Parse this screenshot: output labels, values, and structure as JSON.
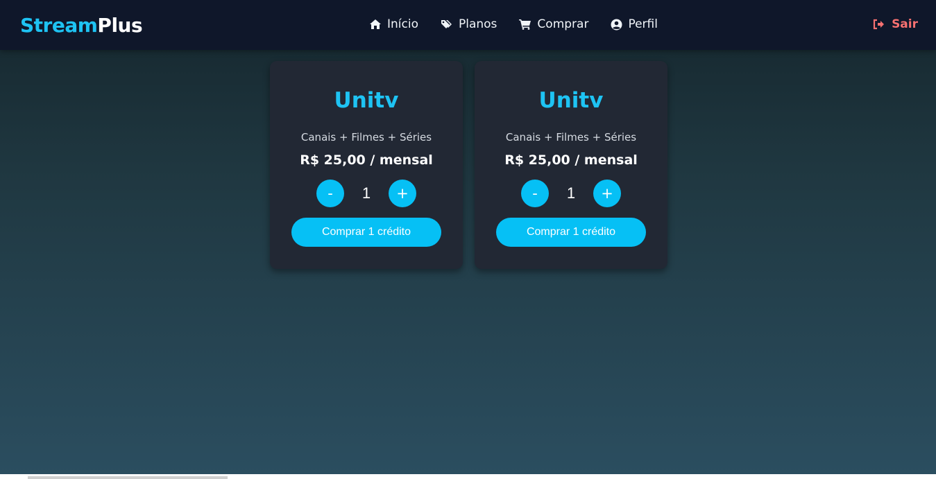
{
  "app": {
    "logo_part1": "Stream",
    "logo_part2": "Plus"
  },
  "nav": {
    "items": [
      {
        "label": "Início",
        "icon": "home-icon"
      },
      {
        "label": "Planos",
        "icon": "tags-icon"
      },
      {
        "label": "Comprar",
        "icon": "cart-icon"
      },
      {
        "label": "Perfil",
        "icon": "user-circle-icon"
      }
    ],
    "logout": {
      "label": "Sair",
      "icon": "sign-out-icon"
    }
  },
  "plans": [
    {
      "title": "Unitv",
      "description": "Canais + Filmes + Séries",
      "price": "R$ 25,00 / mensal",
      "minus_label": "-",
      "quantity": "1",
      "plus_label": "+",
      "buy_label": "Comprar 1 crédito"
    },
    {
      "title": "Unitv",
      "description": "Canais + Filmes + Séries",
      "price": "R$ 25,00 / mensal",
      "minus_label": "-",
      "quantity": "1",
      "plus_label": "+",
      "buy_label": "Comprar 1 crédito"
    }
  ],
  "colors": {
    "accent": "#06c0f5",
    "logo_accent": "#1ec3f3",
    "logout": "#f87171",
    "navbar_bg": "#0f172a",
    "card_bg": "#222834"
  }
}
